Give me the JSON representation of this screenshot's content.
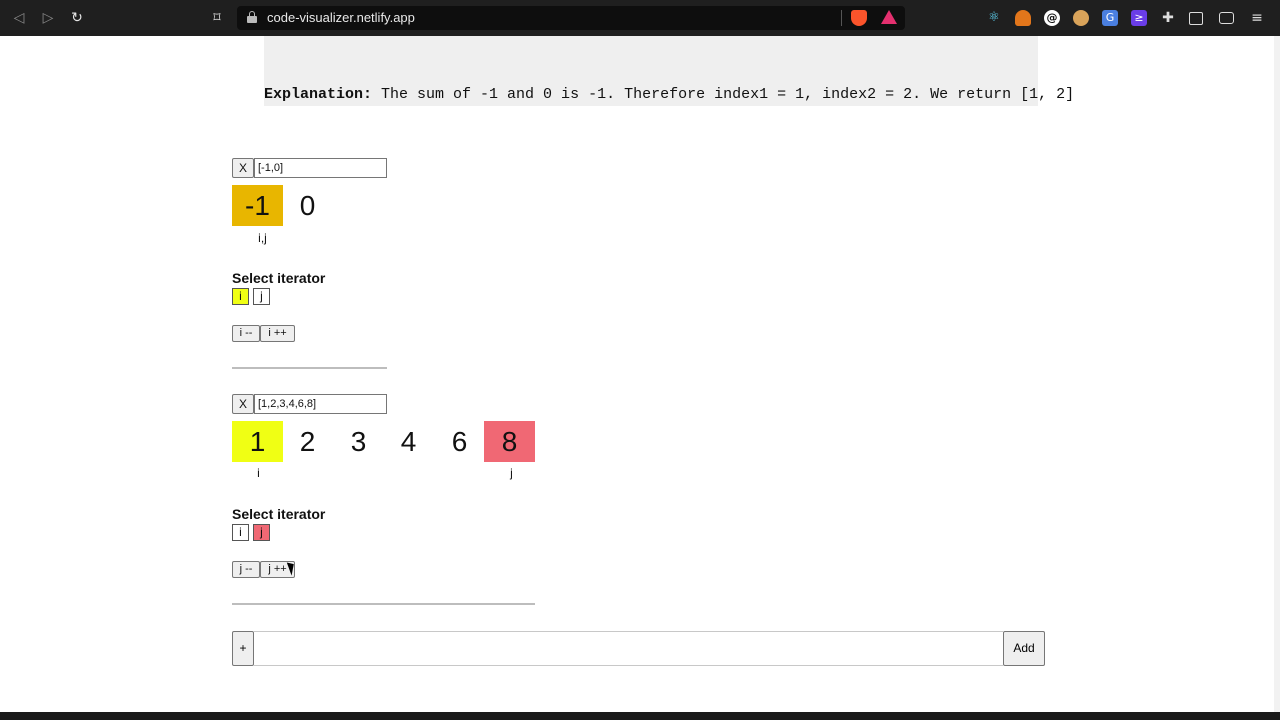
{
  "browser": {
    "url": "code-visualizer.netlify.app",
    "nav": {
      "back": "◁",
      "forward": "▷",
      "reload": "↻",
      "bookmark": "⌑"
    },
    "extensions": [
      "brave-shield-icon",
      "rewards-icon",
      "react-icon",
      "metamask-icon",
      "vpn-icon",
      "cookie-icon",
      "translate-icon",
      "pocket-icon",
      "puzzle-icon",
      "sidebar-icon",
      "wallet-icon",
      "menu-icon"
    ]
  },
  "explanation": {
    "label": "Explanation:",
    "text": " The sum of -1 and 0 is -1. Therefore index1 = 1, index2 = 2. We return [1, 2]"
  },
  "arrays": [
    {
      "remove_label": "X",
      "input_value": "[-1,0]",
      "cells": [
        {
          "value": "-1",
          "highlight": "gold",
          "label": "i,j"
        },
        {
          "value": "0",
          "highlight": "none",
          "label": ""
        }
      ],
      "select_title": "Select iterator",
      "iterators": [
        {
          "name": "i",
          "selected": true
        },
        {
          "name": "j",
          "selected": false
        }
      ],
      "dec_label": "i --",
      "inc_label": "i ++"
    },
    {
      "remove_label": "X",
      "input_value": "[1,2,3,4,6,8]",
      "cells": [
        {
          "value": "1",
          "highlight": "yellow",
          "label": "i"
        },
        {
          "value": "2",
          "highlight": "none",
          "label": ""
        },
        {
          "value": "3",
          "highlight": "none",
          "label": ""
        },
        {
          "value": "4",
          "highlight": "none",
          "label": ""
        },
        {
          "value": "6",
          "highlight": "none",
          "label": ""
        },
        {
          "value": "8",
          "highlight": "red",
          "label": "j"
        }
      ],
      "select_title": "Select iterator",
      "iterators": [
        {
          "name": "i",
          "selected": false
        },
        {
          "name": "j",
          "selected": true
        }
      ],
      "dec_label": "j --",
      "inc_label": "j ++"
    }
  ],
  "add_row": {
    "plus_label": "+",
    "input_value": "",
    "add_label": "Add"
  },
  "colors": {
    "yellow": "#f0ff14",
    "gold": "#e8b600",
    "red": "#f06874"
  }
}
